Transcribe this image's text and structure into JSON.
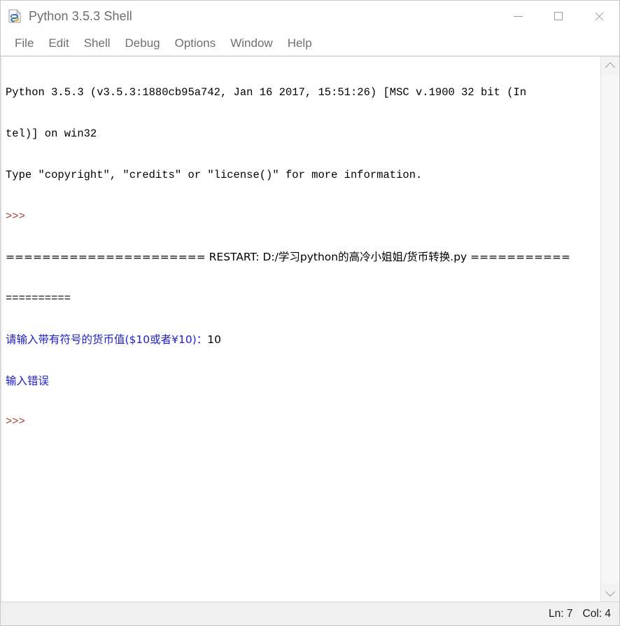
{
  "window": {
    "title": "Python 3.5.3 Shell",
    "icon": "python-idle-file-icon",
    "caption": {
      "minimize": "minimize-icon",
      "maximize": "maximize-icon",
      "close": "close-icon"
    }
  },
  "menubar": {
    "items": [
      {
        "label": "File"
      },
      {
        "label": "Edit"
      },
      {
        "label": "Shell"
      },
      {
        "label": "Debug"
      },
      {
        "label": "Options"
      },
      {
        "label": "Window"
      },
      {
        "label": "Help"
      }
    ]
  },
  "shell": {
    "lines": [
      {
        "text": "Python 3.5.3 (v3.5.3:1880cb95a742, Jan 16 2017, 15:51:26) [MSC v.1900 32 bit (In",
        "color": "black"
      },
      {
        "text": "tel)] on win32",
        "color": "black"
      },
      {
        "text": "Type \"copyright\", \"credits\" or \"license()\" for more information.",
        "color": "black"
      },
      {
        "text": ">>> ",
        "color": "prompt"
      },
      {
        "text": "====================== RESTART: D:/学习python的高冷小姐姐/货币转换.py ===========",
        "color": "black"
      },
      {
        "text": "==========",
        "color": "black"
      },
      {
        "text": "请输入带有符号的货币值($10或者¥10)：10",
        "color": "blue-then-black",
        "blue_part": "请输入带有符号的货币值($10或者¥10)：",
        "black_part": "10"
      },
      {
        "text": "输入错误",
        "color": "blue"
      },
      {
        "text": ">>> ",
        "color": "prompt"
      }
    ]
  },
  "scrollbar": {
    "up_arrow": "chevron-up-icon",
    "down_arrow": "chevron-down-icon"
  },
  "statusbar": {
    "line_label": "Ln: 7",
    "col_label": "Col: 4"
  },
  "colors": {
    "prompt": "#a8403a",
    "output_blue": "#2020cc",
    "text_black": "#000000",
    "chrome": "#f0f0f0"
  }
}
